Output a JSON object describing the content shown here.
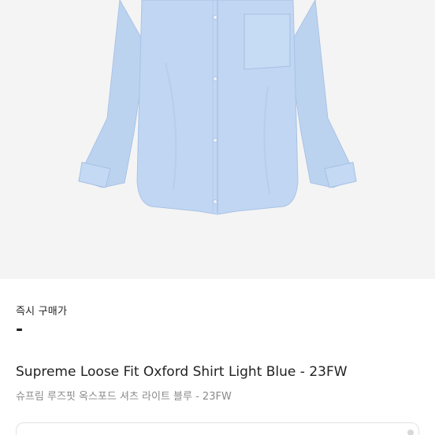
{
  "product": {
    "instant_price_label": "즉시 구매가",
    "instant_price_value": "-",
    "title": "Supreme Loose Fit Oxford Shirt Light Blue - 23FW",
    "subtitle": "슈프림 루즈핏 옥스포드 셔츠 라이트 블루 - 23FW"
  },
  "colors": {
    "image_background": "#f4f4f4",
    "shirt": "#bcd3f0",
    "shirt_shadow": "#a6c0e4",
    "text_primary": "#222222",
    "text_secondary": "#8a8a8a"
  },
  "icons": [
    "product-image"
  ]
}
